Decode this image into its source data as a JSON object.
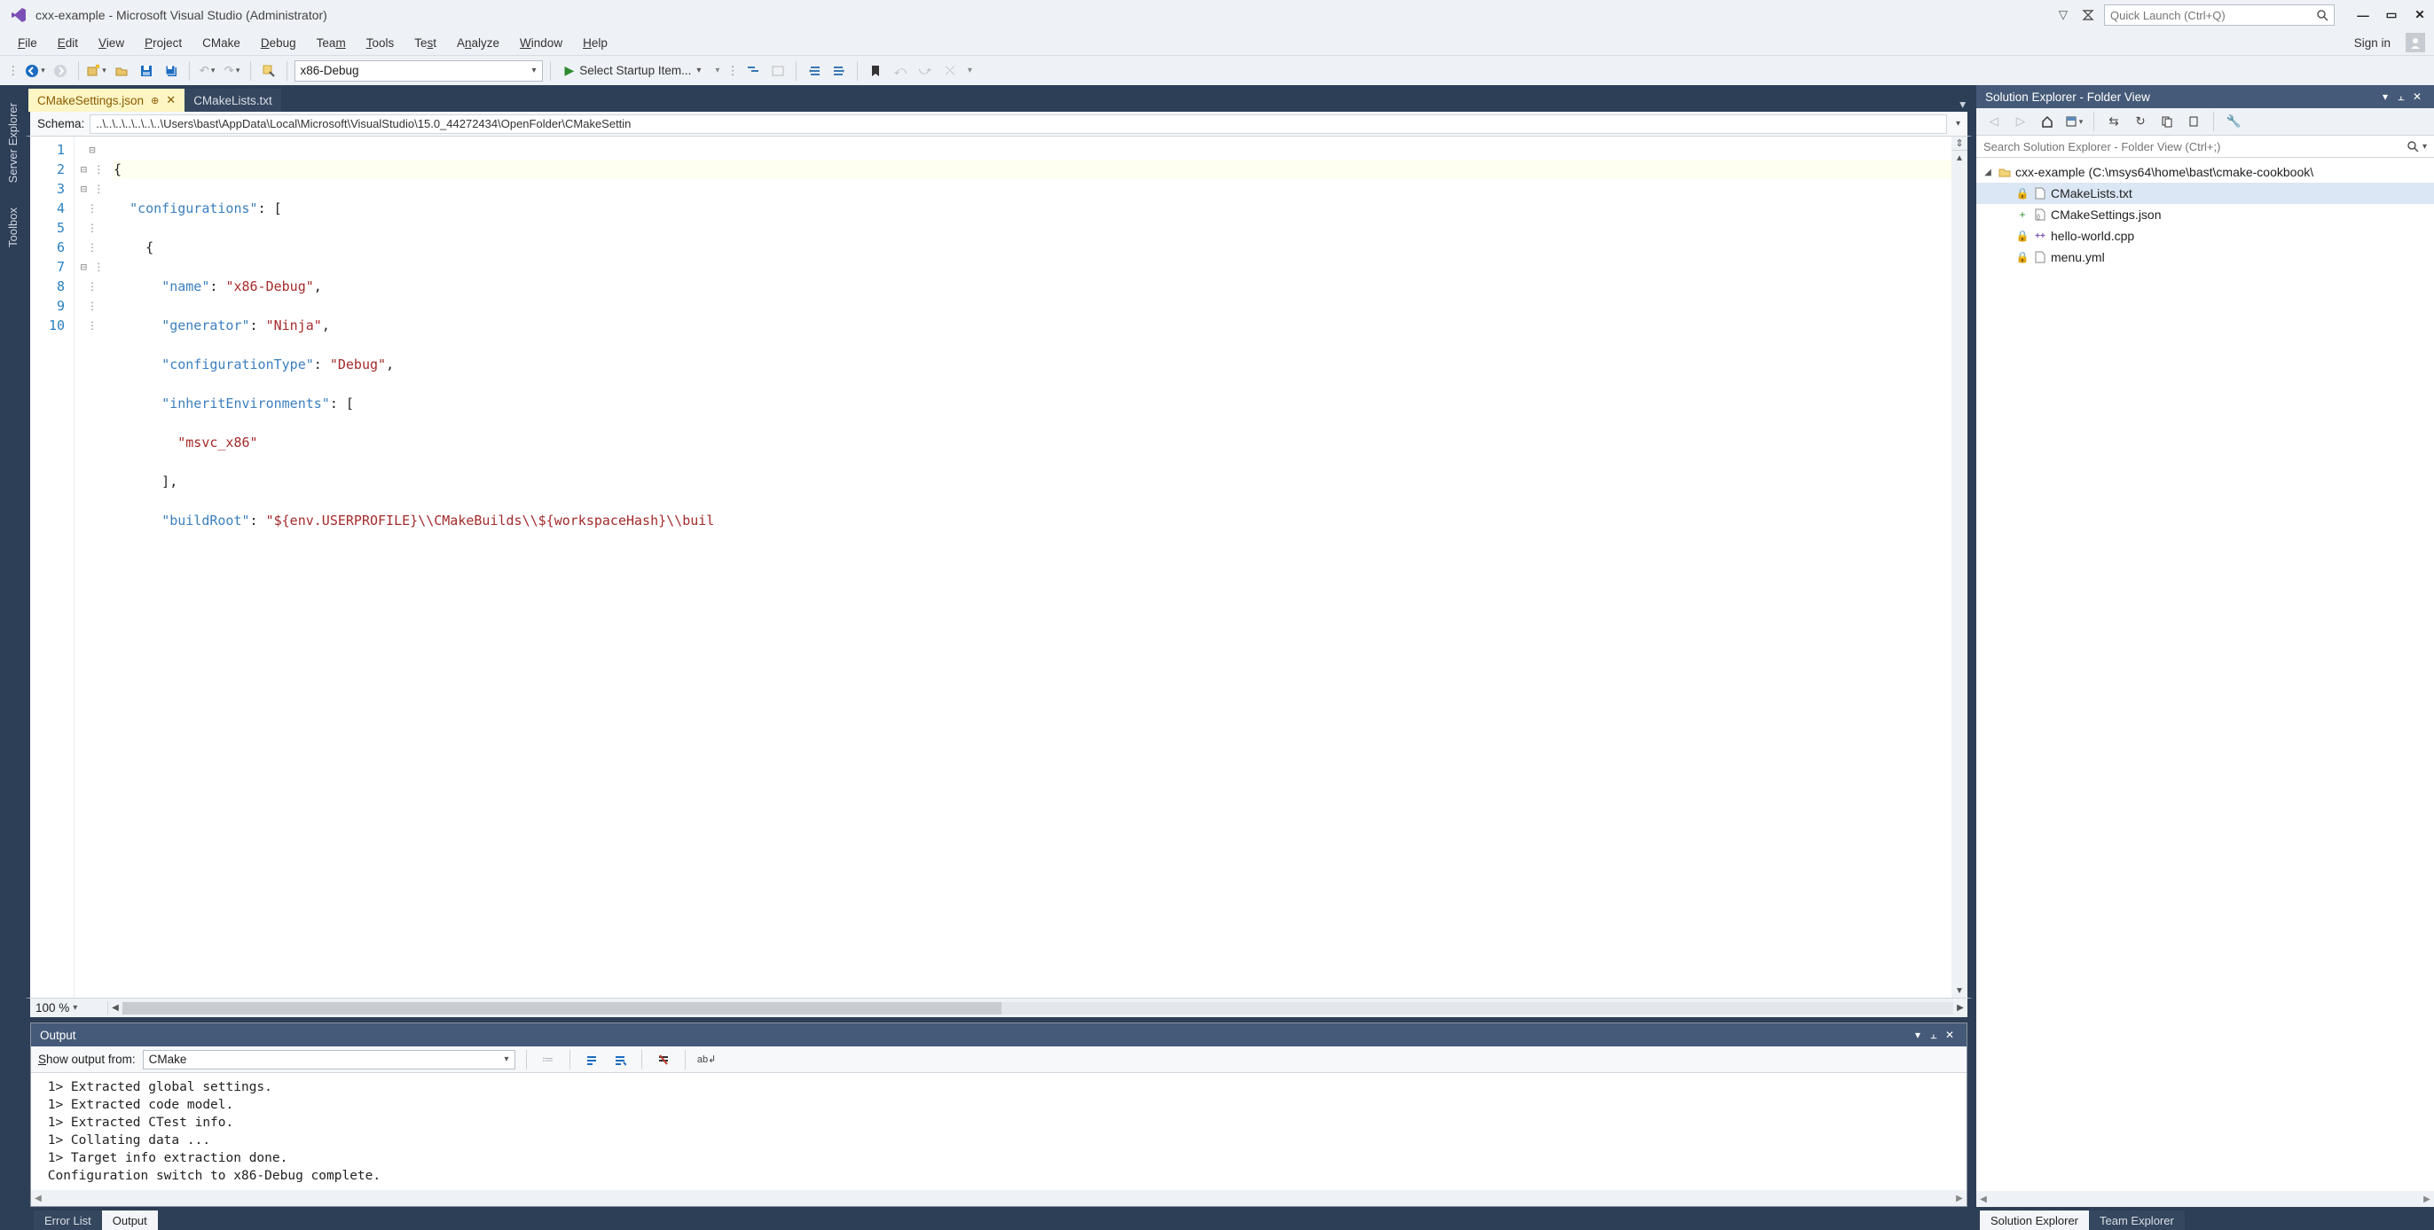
{
  "title_bar": {
    "title": "cxx-example - Microsoft Visual Studio  (Administrator)",
    "quick_launch_placeholder": "Quick Launch (Ctrl+Q)"
  },
  "menu": {
    "file": "File",
    "edit": "Edit",
    "view": "View",
    "project": "Project",
    "cmake": "CMake",
    "debug": "Debug",
    "team": "Team",
    "tools": "Tools",
    "test": "Test",
    "analyze": "Analyze",
    "window": "Window",
    "help": "Help",
    "sign_in": "Sign in"
  },
  "toolbar": {
    "config": "x86-Debug",
    "startup": "Select Startup Item..."
  },
  "side_tabs": {
    "server_explorer": "Server Explorer",
    "toolbox": "Toolbox"
  },
  "editor": {
    "tabs": {
      "active": "CMakeSettings.json",
      "inactive": "CMakeLists.txt"
    },
    "schema_label": "Schema:",
    "schema_value": "..\\..\\..\\..\\..\\..\\..\\Users\\bast\\AppData\\Local\\Microsoft\\VisualStudio\\15.0_44272434\\OpenFolder\\CMakeSettin",
    "zoom": "100 %",
    "lines": {
      "l1": "{",
      "l2_key": "\"configurations\"",
      "l2_rest": ": [",
      "l3": "    {",
      "l4_key": "\"name\"",
      "l4_val": "\"x86-Debug\"",
      "l5_key": "\"generator\"",
      "l5_val": "\"Ninja\"",
      "l6_key": "\"configurationType\"",
      "l6_val": "\"Debug\"",
      "l7_key": "\"inheritEnvironments\"",
      "l7_rest": ": [",
      "l8_val": "\"msvc_x86\"",
      "l9": "      ],",
      "l10_key": "\"buildRoot\"",
      "l10_val": "\"${env.USERPROFILE}\\\\CMakeBuilds\\\\${workspaceHash}\\\\buil"
    },
    "line_numbers": [
      "1",
      "2",
      "3",
      "4",
      "5",
      "6",
      "7",
      "8",
      "9",
      "10"
    ]
  },
  "output": {
    "title": "Output",
    "show_from_label": "Show output from:",
    "show_from_value": "CMake",
    "lines": [
      " 1> Extracted global settings.",
      " 1> Extracted code model.",
      " 1> Extracted CTest info.",
      " 1> Collating data ...",
      " 1> Target info extraction done.",
      " Configuration switch to x86-Debug complete."
    ]
  },
  "bottom_tabs": {
    "error_list": "Error List",
    "output": "Output"
  },
  "solution_explorer": {
    "title": "Solution Explorer - Folder View",
    "search_placeholder": "Search Solution Explorer - Folder View (Ctrl+;)",
    "root": "cxx-example (C:\\msys64\\home\\bast\\cmake-cookbook\\",
    "files": {
      "cmakelists": "CMakeLists.txt",
      "cmakesettings": "CMakeSettings.json",
      "hello": "hello-world.cpp",
      "menu": "menu.yml"
    },
    "bottom_tabs": {
      "sol": "Solution Explorer",
      "team": "Team Explorer"
    }
  }
}
